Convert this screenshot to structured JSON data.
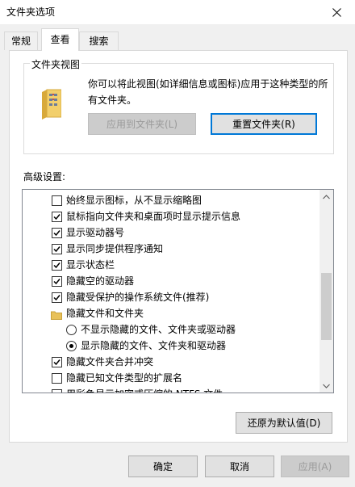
{
  "window": {
    "title": "文件夹选项"
  },
  "tabs": [
    {
      "label": "常规"
    },
    {
      "label": "查看"
    },
    {
      "label": "搜索"
    }
  ],
  "folder_views": {
    "legend": "文件夹视图",
    "description": "你可以将此视图(如详细信息或图标)应用于这种类型的所有文件夹。",
    "apply_button": "应用到文件夹(L)",
    "reset_button": "重置文件夹(R)"
  },
  "advanced": {
    "label": "高级设置:",
    "items": [
      {
        "type": "checkbox",
        "checked": false,
        "label": "始终显示图标，从不显示缩略图"
      },
      {
        "type": "checkbox",
        "checked": true,
        "label": "鼠标指向文件夹和桌面项时显示提示信息"
      },
      {
        "type": "checkbox",
        "checked": true,
        "label": "显示驱动器号"
      },
      {
        "type": "checkbox",
        "checked": true,
        "label": "显示同步提供程序通知"
      },
      {
        "type": "checkbox",
        "checked": true,
        "label": "显示状态栏"
      },
      {
        "type": "checkbox",
        "checked": true,
        "label": "隐藏空的驱动器"
      },
      {
        "type": "checkbox",
        "checked": true,
        "label": "隐藏受保护的操作系统文件(推荐)"
      },
      {
        "type": "folder",
        "label": "隐藏文件和文件夹"
      },
      {
        "type": "radio",
        "checked": false,
        "label": "不显示隐藏的文件、文件夹或驱动器"
      },
      {
        "type": "radio",
        "checked": true,
        "label": "显示隐藏的文件、文件夹和驱动器"
      },
      {
        "type": "checkbox",
        "checked": true,
        "label": "隐藏文件夹合并冲突"
      },
      {
        "type": "checkbox",
        "checked": false,
        "label": "隐藏已知文件类型的扩展名"
      },
      {
        "type": "checkbox",
        "checked": false,
        "label": "用彩色显示加密或压缩的 NTFS 文件"
      }
    ],
    "restore_defaults": "还原为默认值(D)"
  },
  "footer": {
    "ok": "确定",
    "cancel": "取消",
    "apply": "应用(A)"
  },
  "icons": {
    "close": "close-icon",
    "folder": "folder-icon",
    "scroll_up": "chevron-up-icon",
    "scroll_down": "chevron-down-icon"
  },
  "colors": {
    "focus": "#0078d7",
    "folder": "#e8c15a"
  }
}
